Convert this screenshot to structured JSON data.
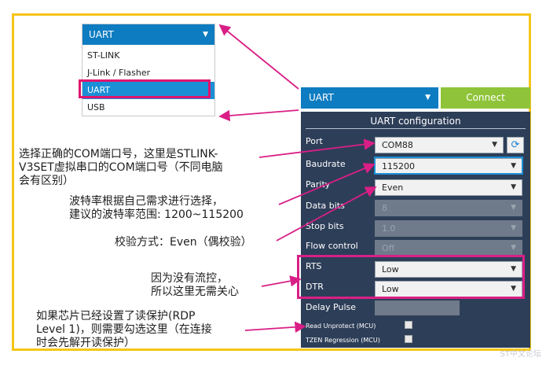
{
  "dropdown": {
    "selected": "UART",
    "items": [
      "ST-LINK",
      "J-Link / Flasher",
      "UART",
      "USB"
    ]
  },
  "topbar": {
    "interface": "UART",
    "connect_label": "Connect"
  },
  "panel": {
    "title": "UART configuration",
    "port": {
      "label": "Port",
      "value": "COM88"
    },
    "baudrate": {
      "label": "Baudrate",
      "value": "115200"
    },
    "parity": {
      "label": "Parity",
      "value": "Even"
    },
    "databits": {
      "label": "Data bits",
      "value": "8"
    },
    "stopbits": {
      "label": "Stop bits",
      "value": "1.0"
    },
    "flow": {
      "label": "Flow control",
      "value": "Off"
    },
    "rts": {
      "label": "RTS",
      "value": "Low"
    },
    "dtr": {
      "label": "DTR",
      "value": "Low"
    },
    "delay": {
      "label": "Delay Pulse"
    },
    "read_unprotect": {
      "label": "Read Unprotect (MCU)"
    },
    "tzen": {
      "label": "TZEN Regression (MCU)"
    }
  },
  "annotations": {
    "port_l1": "选择正确的COM端口号，这里是STLINK-",
    "port_l2": "V3SET虚拟串口的COM端口号（不同电脑",
    "port_l3": "会有区别）",
    "baud_l1": "波特率根据自己需求进行选择，",
    "baud_l2": "建议的波特率范围: 1200~115200",
    "parity": "校验方式：Even（偶校验）",
    "flow_l1": "因为没有流控，",
    "flow_l2": "所以这里无需关心",
    "rdp_l1": "如果芯片已经设置了读保护(RDP",
    "rdp_l2": "Level 1)，则需要勾选这里（在连接",
    "rdp_l3": "时会先解开读保护）"
  },
  "watermark": "ST中文论坛"
}
